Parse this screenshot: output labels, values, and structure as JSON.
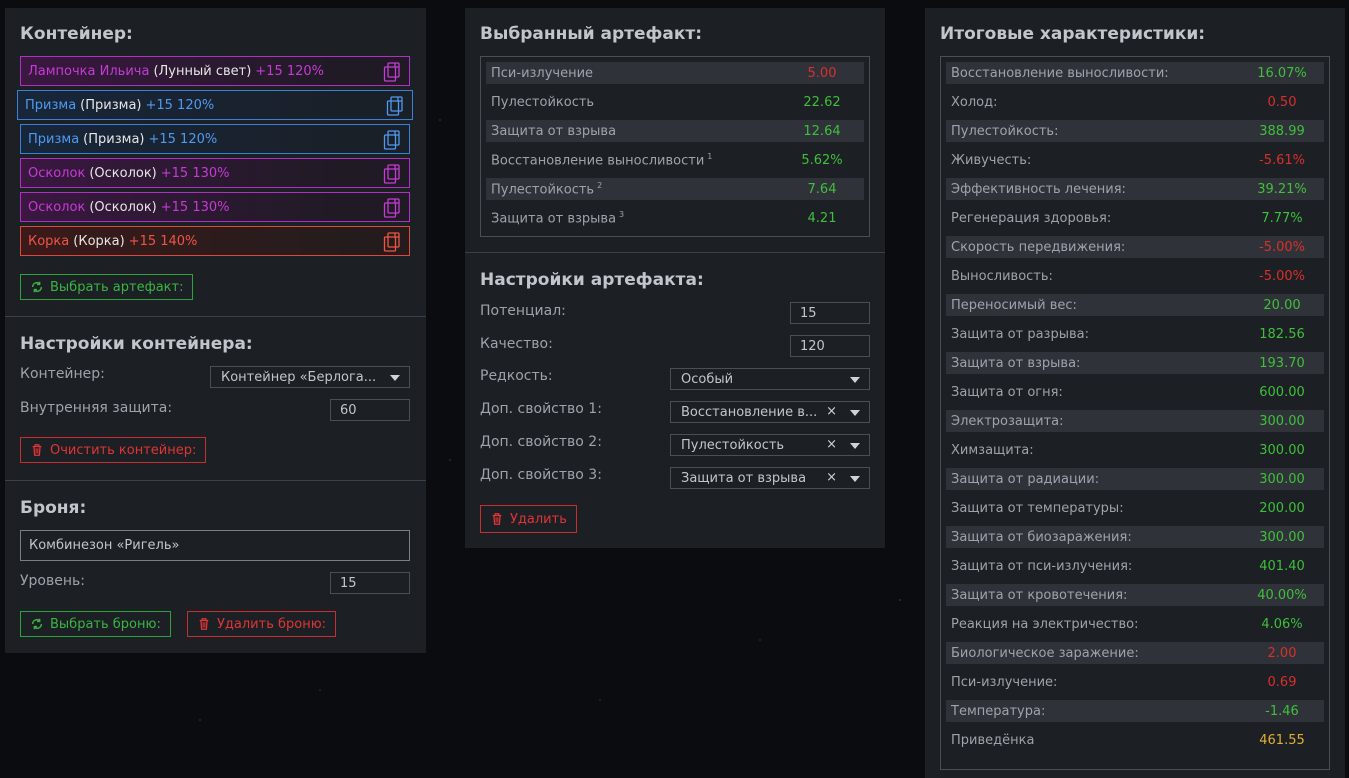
{
  "container_panel": {
    "title": "Контейнер:",
    "slots": [
      {
        "name": "Лампочка Ильича",
        "type": "(Лунный свет)",
        "bonus": "+15 120%",
        "color": "purple"
      },
      {
        "name": "Призма",
        "type": "(Призма)",
        "bonus": "+15 120%",
        "color": "blue"
      },
      {
        "name": "Призма",
        "type": "(Призма)",
        "bonus": "+15 120%",
        "color": "blue"
      },
      {
        "name": "Осколок",
        "type": "(Осколок)",
        "bonus": "+15 130%",
        "color": "purple"
      },
      {
        "name": "Осколок",
        "type": "(Осколок)",
        "bonus": "+15 130%",
        "color": "purple"
      },
      {
        "name": "Корка",
        "type": "(Корка)",
        "bonus": "+15 140%",
        "color": "red"
      }
    ],
    "select_artifact_button": "Выбрать артефакт:",
    "settings_title": "Настройки контейнера:",
    "container_label": "Контейнер:",
    "container_value": "Контейнер «Берлога...",
    "inner_protection_label": "Внутренняя защита:",
    "inner_protection_value": "60",
    "clear_button": "Очистить контейнер:",
    "armor_title": "Броня:",
    "armor_value": "Комбинезон «Ригель»",
    "level_label": "Уровень:",
    "level_value": "15",
    "select_armor_button": "Выбрать броню:",
    "delete_armor_button": "Удалить броню:"
  },
  "artifact_panel": {
    "title": "Выбранный артефакт:",
    "stats": [
      {
        "key": "Пси-излучение",
        "sup": "",
        "value": "5.00",
        "tone": "neg"
      },
      {
        "key": "Пулестойкость",
        "sup": "",
        "value": "22.62",
        "tone": "pos"
      },
      {
        "key": "Защита от взрыва",
        "sup": "",
        "value": "12.64",
        "tone": "pos"
      },
      {
        "key": "Восстановление выносливости",
        "sup": "1",
        "value": "5.62%",
        "tone": "pos"
      },
      {
        "key": "Пулестойкость",
        "sup": "2",
        "value": "7.64",
        "tone": "pos"
      },
      {
        "key": "Защита от взрыва",
        "sup": "3",
        "value": "4.21",
        "tone": "pos"
      }
    ],
    "settings_title": "Настройки артефакта:",
    "potential_label": "Потенциал:",
    "potential_value": "15",
    "quality_label": "Качество:",
    "quality_value": "120",
    "rarity_label": "Редкость:",
    "rarity_value": "Особый",
    "extra1_label": "Доп. свойство 1:",
    "extra1_value": "Восстановление в...",
    "extra2_label": "Доп. свойство 2:",
    "extra2_value": "Пулестойкость",
    "extra3_label": "Доп. свойство 3:",
    "extra3_value": "Защита от взрыва",
    "clear_symbol": "×",
    "delete_button": "Удалить"
  },
  "totals_panel": {
    "title": "Итоговые характеристики:",
    "stats": [
      {
        "key": "Восстановление выносливости:",
        "value": "16.07%",
        "tone": "pos"
      },
      {
        "key": "Холод:",
        "value": "0.50",
        "tone": "neg"
      },
      {
        "key": "Пулестойкость:",
        "value": "388.99",
        "tone": "pos"
      },
      {
        "key": "Живучесть:",
        "value": "-5.61%",
        "tone": "neg"
      },
      {
        "key": "Эффективность лечения:",
        "value": "39.21%",
        "tone": "pos"
      },
      {
        "key": "Регенерация здоровья:",
        "value": "7.77%",
        "tone": "pos"
      },
      {
        "key": "Скорость передвижения:",
        "value": "-5.00%",
        "tone": "neg"
      },
      {
        "key": "Выносливость:",
        "value": "-5.00%",
        "tone": "neg"
      },
      {
        "key": "Переносимый вес:",
        "value": "20.00",
        "tone": "pos"
      },
      {
        "key": "Защита от разрыва:",
        "value": "182.56",
        "tone": "pos"
      },
      {
        "key": "Защита от взрыва:",
        "value": "193.70",
        "tone": "pos"
      },
      {
        "key": "Защита от огня:",
        "value": "600.00",
        "tone": "pos"
      },
      {
        "key": "Электрозащита:",
        "value": "300.00",
        "tone": "pos"
      },
      {
        "key": "Химзащита:",
        "value": "300.00",
        "tone": "pos"
      },
      {
        "key": "Защита от радиации:",
        "value": "300.00",
        "tone": "pos"
      },
      {
        "key": "Защита от температуры:",
        "value": "200.00",
        "tone": "pos"
      },
      {
        "key": "Защита от биозаражения:",
        "value": "300.00",
        "tone": "pos"
      },
      {
        "key": "Защита от пси-излучения:",
        "value": "401.40",
        "tone": "pos"
      },
      {
        "key": "Защита от кровотечения:",
        "value": "40.00%",
        "tone": "pos"
      },
      {
        "key": "Реакция на электричество:",
        "value": "4.06%",
        "tone": "pos"
      },
      {
        "key": "Биологическое заражение:",
        "value": "2.00",
        "tone": "neg"
      },
      {
        "key": "Пси-излучение:",
        "value": "0.69",
        "tone": "neg"
      },
      {
        "key": "Температура:",
        "value": "-1.46",
        "tone": "pos"
      },
      {
        "key": "Приведёнка",
        "value": "461.55",
        "tone": "gold"
      }
    ]
  },
  "colors": {
    "purple": "#c63ad6",
    "blue": "#4f9af0",
    "red": "#f05446",
    "positive": "#3fbf3a",
    "negative": "#d9302a",
    "gold": "#e0b030",
    "panel": "#1c1f24"
  },
  "icons": {
    "copy": "copy-icon",
    "refresh": "refresh-icon",
    "trash": "trash-icon",
    "caret": "chevron-down-icon"
  }
}
